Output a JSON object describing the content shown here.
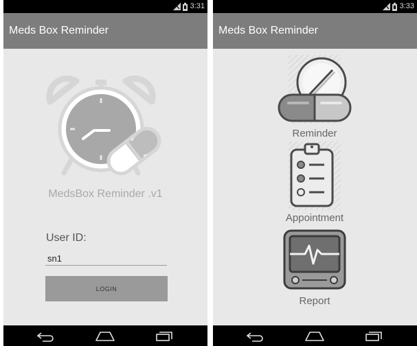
{
  "left_screen": {
    "status": {
      "time": "3:31",
      "icons": [
        "no-sim-icon",
        "battery-icon"
      ]
    },
    "app_bar": {
      "title": "Meds Box Reminder"
    },
    "logo": {
      "icon": "alarm-clock-pill-icon"
    },
    "version_label": "MedsBox Reminder .v1",
    "user_id_label": "User ID:",
    "user_id_value": "sn1",
    "login_label": "LOGIN",
    "nav": [
      "back-icon",
      "home-icon",
      "recents-icon"
    ]
  },
  "right_screen": {
    "status": {
      "time": "3:33",
      "icons": [
        "no-sim-icon",
        "battery-icon"
      ]
    },
    "app_bar": {
      "title": "Meds Box Reminder"
    },
    "menu": [
      {
        "label": "Reminder",
        "icon": "pill-capsule-icon"
      },
      {
        "label": "Appointment",
        "icon": "clipboard-checklist-icon"
      },
      {
        "label": "Report",
        "icon": "heart-monitor-icon"
      }
    ],
    "nav": [
      "back-icon",
      "home-icon",
      "recents-icon"
    ]
  }
}
